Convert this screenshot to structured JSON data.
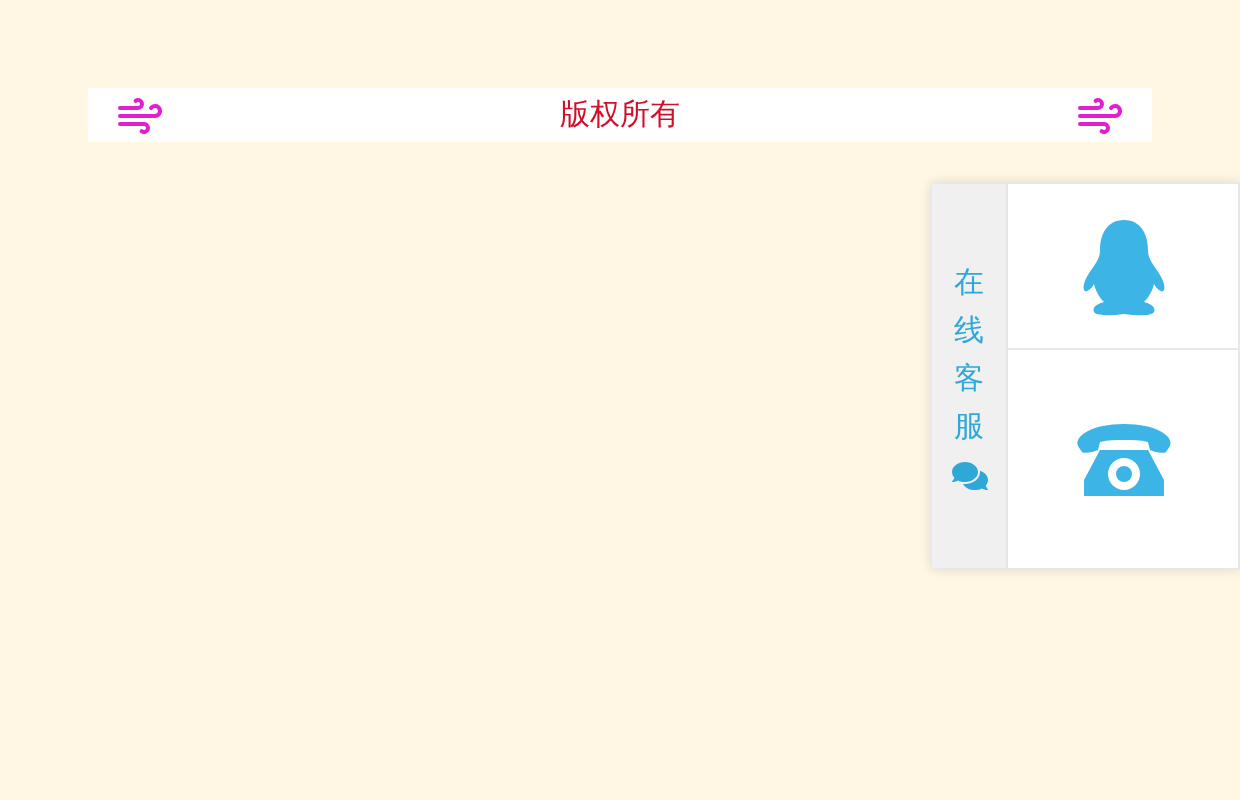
{
  "banner": {
    "text": "版权所有"
  },
  "service_panel": {
    "tab_label": "在线客服"
  }
}
